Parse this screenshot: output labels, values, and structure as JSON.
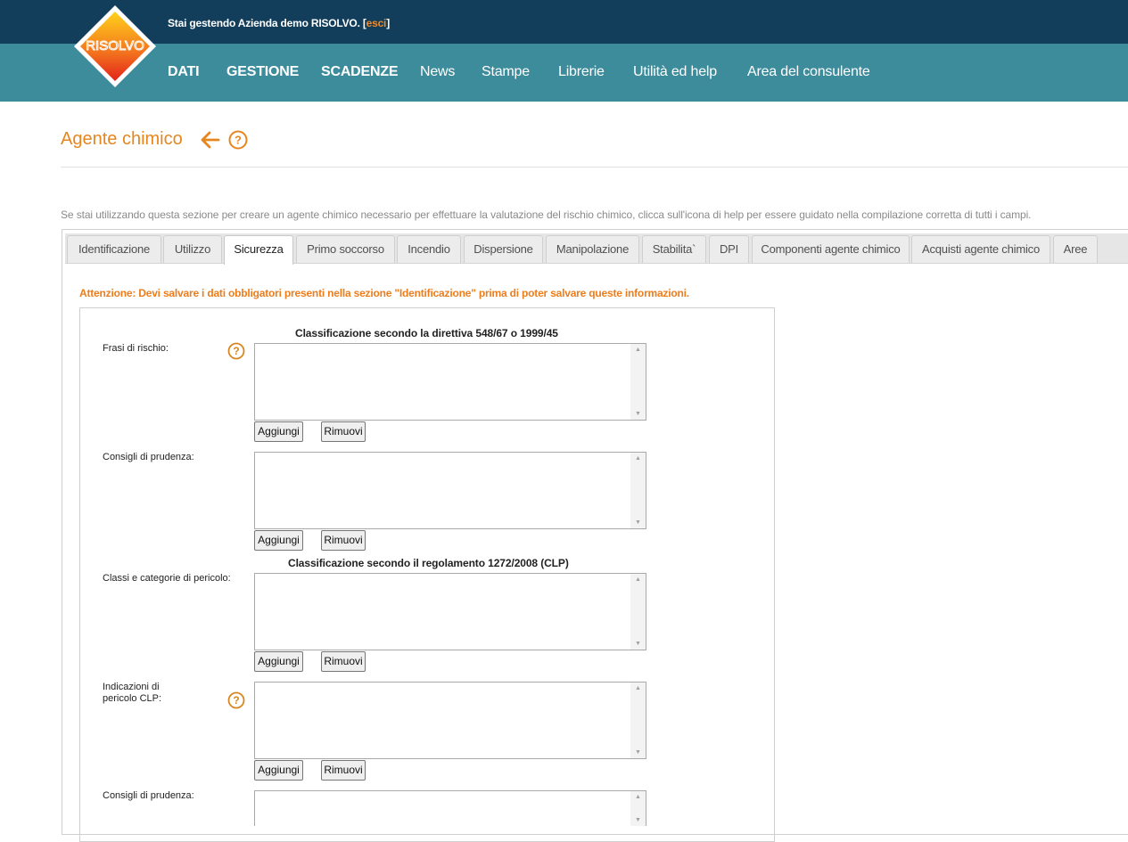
{
  "header": {
    "manage_prefix": "Stai gestendo Azienda demo RISOLVO. [",
    "exit_link": "esci",
    "manage_suffix": "]",
    "logo_text": "RISOLVO"
  },
  "nav": {
    "items": [
      "DATI",
      "GESTIONE",
      "SCADENZE",
      "News",
      "Stampe",
      "Librerie",
      "Utilità ed help",
      "Area del consulente"
    ]
  },
  "page": {
    "title": "Agente chimico",
    "intro": "Se stai utilizzando questa sezione per creare un agente chimico necessario per effettuare la valutazione del rischio chimico, clicca sull'icona di help per essere guidato nella compilazione corretta di tutti i campi."
  },
  "tabs": [
    "Identificazione",
    "Utilizzo",
    "Sicurezza",
    "Primo soccorso",
    "Incendio",
    "Dispersione",
    "Manipolazione",
    "Stabilita`",
    "DPI",
    "Componenti agente chimico",
    "Acquisti agente chimico",
    "Aree"
  ],
  "active_tab": "Sicurezza",
  "form": {
    "warning": "Attenzione: Devi salvare i dati obbligatori presenti nella sezione \"Identificazione\" prima di poter salvare queste informazioni.",
    "section1_title": "Classificazione secondo la direttiva 548/67 o 1999/45",
    "section2_title": "Classificazione secondo il regolamento 1272/2008 (CLP)",
    "fields": {
      "frasi_rischio": "Frasi di rischio:",
      "consigli_prudenza_1": "Consigli di prudenza:",
      "classi_categorie": "Classi e categorie di pericolo:",
      "indicazioni_line1": "Indicazioni di",
      "indicazioni_line2": "pericolo CLP:",
      "consigli_prudenza_2": "Consigli di prudenza:"
    },
    "add_label": "Aggiungi",
    "remove_label": "Rimuovi"
  },
  "colors": {
    "topbar": "#123e5c",
    "navbar": "#3d8c9c",
    "accent": "#e5861f"
  },
  "icons": [
    "logo-icon",
    "back-arrow-icon",
    "help-icon",
    "scroll-up-icon",
    "scroll-down-icon"
  ]
}
